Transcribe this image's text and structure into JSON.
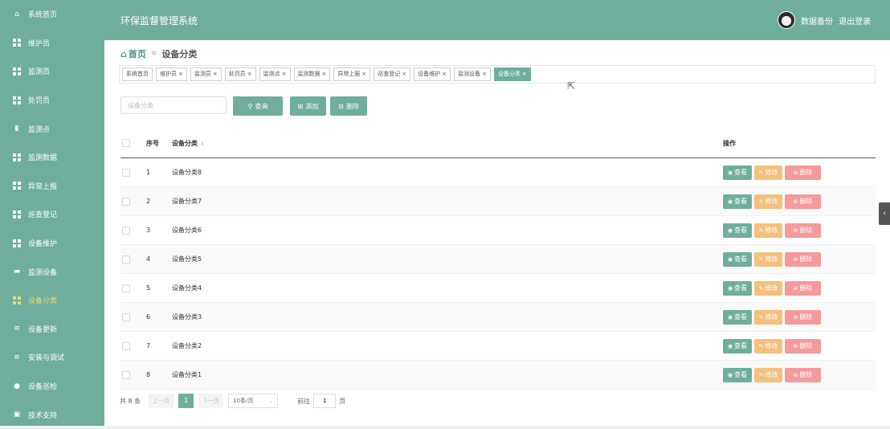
{
  "app": {
    "title": "环保监督管理系统"
  },
  "header": {
    "backup_label": "数据备份",
    "logout_label": "退出登录"
  },
  "sidebar": {
    "items": [
      {
        "label": "系统首页",
        "icon": "home-icon"
      },
      {
        "label": "维护员",
        "icon": "grid-icon"
      },
      {
        "label": "监测员",
        "icon": "grid-icon"
      },
      {
        "label": "处罚员",
        "icon": "grid-icon"
      },
      {
        "label": "监测点",
        "icon": "clipboard-icon"
      },
      {
        "label": "监测数据",
        "icon": "grid-icon"
      },
      {
        "label": "异常上报",
        "icon": "grid-icon"
      },
      {
        "label": "巡查登记",
        "icon": "grid-icon"
      },
      {
        "label": "设备维护",
        "icon": "grid-icon"
      },
      {
        "label": "监测设备",
        "icon": "briefcase-icon"
      },
      {
        "label": "设备分类",
        "icon": "grid-icon",
        "active": true
      },
      {
        "label": "设备更新",
        "icon": "list-icon"
      },
      {
        "label": "安装与调试",
        "icon": "list-icon"
      },
      {
        "label": "设备巡检",
        "icon": "location-icon"
      },
      {
        "label": "技术支持",
        "icon": "edit-icon"
      }
    ]
  },
  "breadcrumb": {
    "home": "首页",
    "current": "设备分类"
  },
  "tags": [
    {
      "label": "系统首页",
      "closable": false
    },
    {
      "label": "维护员",
      "closable": true
    },
    {
      "label": "监测员",
      "closable": true
    },
    {
      "label": "处罚员",
      "closable": true
    },
    {
      "label": "监测点",
      "closable": true
    },
    {
      "label": "监测数据",
      "closable": true
    },
    {
      "label": "异常上报",
      "closable": true
    },
    {
      "label": "巡查登记",
      "closable": true
    },
    {
      "label": "设备维护",
      "closable": true
    },
    {
      "label": "监测设备",
      "closable": true
    },
    {
      "label": "设备分类",
      "closable": true,
      "active": true
    }
  ],
  "tag_close": "×",
  "search": {
    "placeholder": "设备分类",
    "value": ""
  },
  "toolbar": {
    "query_label": "查询",
    "add_label": "添加",
    "delete_label": "删除"
  },
  "table": {
    "columns": {
      "index": "序号",
      "category": "设备分类",
      "actions": "操作"
    },
    "rows": [
      {
        "index": "1",
        "category": "设备分类8"
      },
      {
        "index": "2",
        "category": "设备分类7"
      },
      {
        "index": "3",
        "category": "设备分类6"
      },
      {
        "index": "4",
        "category": "设备分类5"
      },
      {
        "index": "5",
        "category": "设备分类4"
      },
      {
        "index": "6",
        "category": "设备分类3"
      },
      {
        "index": "7",
        "category": "设备分类2"
      },
      {
        "index": "8",
        "category": "设备分类1"
      }
    ],
    "actions": {
      "view": "查看",
      "edit": "修改",
      "delete": "删除"
    }
  },
  "pagination": {
    "total": "共 8 条",
    "prev": "上一页",
    "current_page": "1",
    "next": "下一页",
    "page_size": "10条/页",
    "goto_label": "前往",
    "goto_value": "1",
    "page_unit": "页"
  },
  "colors": {
    "primary": "#6fae9c",
    "edit": "#f3c17d",
    "delete": "#f49a9a",
    "active_menu": "#f0d66f"
  }
}
